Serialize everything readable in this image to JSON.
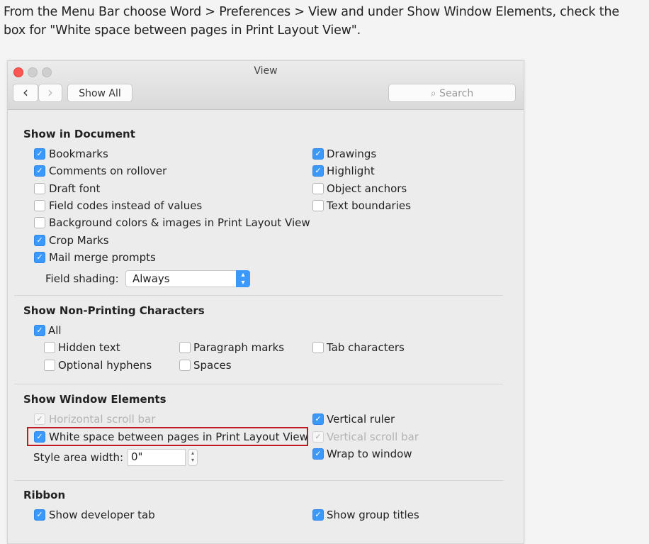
{
  "instruction": "From the Menu Bar choose Word > Preferences > View and under Show Window Elements, check the box for \"White space between pages in Print Layout View\".",
  "window": {
    "title": "View",
    "show_all": "Show All",
    "search_placeholder": "Search",
    "back": "‹",
    "forward": "›"
  },
  "show_in_document": {
    "heading": "Show in Document",
    "items": [
      {
        "label": "Bookmarks",
        "checked": true
      },
      {
        "label": "Comments on rollover",
        "checked": true
      },
      {
        "label": "Draft font",
        "checked": false
      },
      {
        "label": "Field codes instead of values",
        "checked": false
      },
      {
        "label": "Background colors & images in Print Layout View",
        "checked": false
      },
      {
        "label": "Crop Marks",
        "checked": true
      },
      {
        "label": "Mail merge prompts",
        "checked": true
      },
      {
        "label": "Drawings",
        "checked": true
      },
      {
        "label": "Highlight",
        "checked": true
      },
      {
        "label": "Object anchors",
        "checked": false
      },
      {
        "label": "Text boundaries",
        "checked": false
      }
    ],
    "field_shading_label": "Field shading:",
    "field_shading_value": "Always"
  },
  "non_printing": {
    "heading": "Show Non-Printing Characters",
    "items": [
      {
        "label": "All",
        "checked": true
      },
      {
        "label": "Hidden text",
        "checked": false
      },
      {
        "label": "Optional hyphens",
        "checked": false
      },
      {
        "label": "Paragraph marks",
        "checked": false
      },
      {
        "label": "Spaces",
        "checked": false
      },
      {
        "label": "Tab characters",
        "checked": false
      }
    ]
  },
  "window_elements": {
    "heading": "Show Window Elements",
    "items": [
      {
        "label": "Horizontal scroll bar",
        "checked": true,
        "disabled": true
      },
      {
        "label": "White space between pages in Print Layout View",
        "checked": true,
        "highlighted": true
      },
      {
        "label": "Vertical ruler",
        "checked": true
      },
      {
        "label": "Vertical scroll bar",
        "checked": true,
        "disabled": true
      },
      {
        "label": "Wrap to window",
        "checked": true
      }
    ],
    "style_area_label": "Style area width:",
    "style_area_value": "0\""
  },
  "ribbon": {
    "heading": "Ribbon",
    "items": [
      {
        "label": "Show developer tab",
        "checked": true
      },
      {
        "label": "Show group titles",
        "checked": true
      }
    ]
  },
  "colors": {
    "checkbox": "#3b99fc",
    "highlight_box": "#c0191f",
    "close_button": "#fc5753"
  }
}
